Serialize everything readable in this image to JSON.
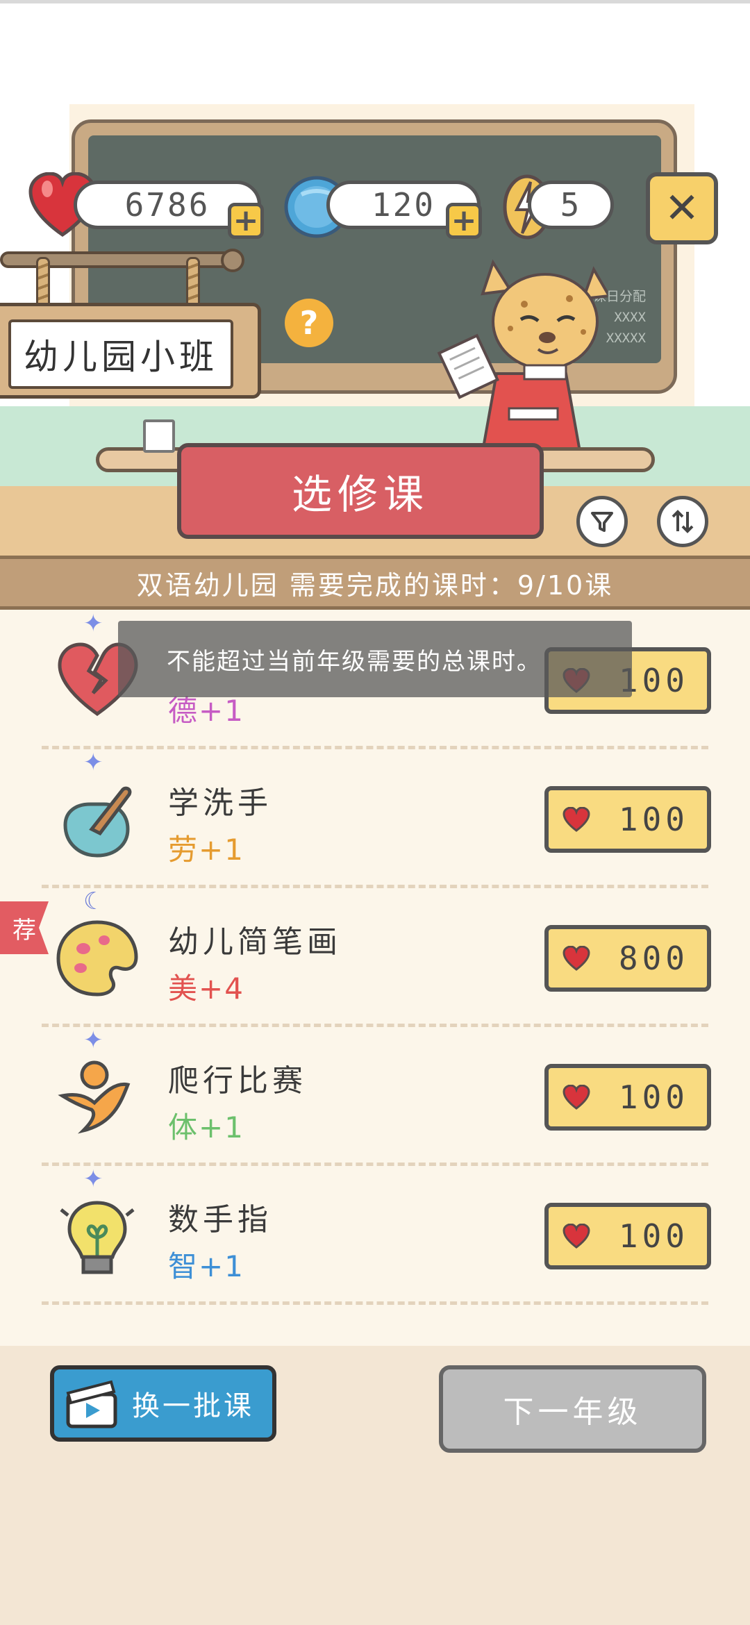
{
  "resources": {
    "hearts": "6786",
    "coins": "120",
    "energy": "5",
    "plus_label": "+"
  },
  "close_label": "✕",
  "board_scribble": [
    "课日分配",
    "XXXX",
    "XXXXX"
  ],
  "grade_sign": "幼儿园小班",
  "help_label": "?",
  "elective_label": "选修课",
  "filter_icon": "funnel-icon",
  "sort_icon": "sort-arrows-icon",
  "progress_text": "双语幼儿园 需要完成的课时：9/10课",
  "toast": "不能超过当前年级需要的总课时。",
  "recommend_tag": "荐",
  "courses": [
    {
      "name": "",
      "bonus": "德+1",
      "bonus_color": "#c65bc4",
      "price": "100",
      "icon": "broken-heart-icon"
    },
    {
      "name": "学洗手",
      "bonus": "劳+1",
      "bonus_color": "#e59b2f",
      "price": "100",
      "icon": "hand-washing-icon"
    },
    {
      "name": "幼儿简笔画",
      "bonus": "美+4",
      "bonus_color": "#e2524f",
      "price": "800",
      "icon": "paint-palette-icon"
    },
    {
      "name": "爬行比赛",
      "bonus": "体+1",
      "bonus_color": "#6cc06c",
      "price": "100",
      "icon": "running-person-icon"
    },
    {
      "name": "数手指",
      "bonus": "智+1",
      "bonus_color": "#3d8fd6",
      "price": "100",
      "icon": "lightbulb-icon"
    }
  ],
  "bottom": {
    "swap_label": "换一批课",
    "next_label": "下一年级"
  },
  "colors": {
    "heart": "#d8343c",
    "coin": "#4ea6d8",
    "button_yellow": "#f9db81",
    "elective_red": "#d85f64",
    "swap_blue": "#3a9ccf",
    "next_gray": "#bcbcbc"
  }
}
